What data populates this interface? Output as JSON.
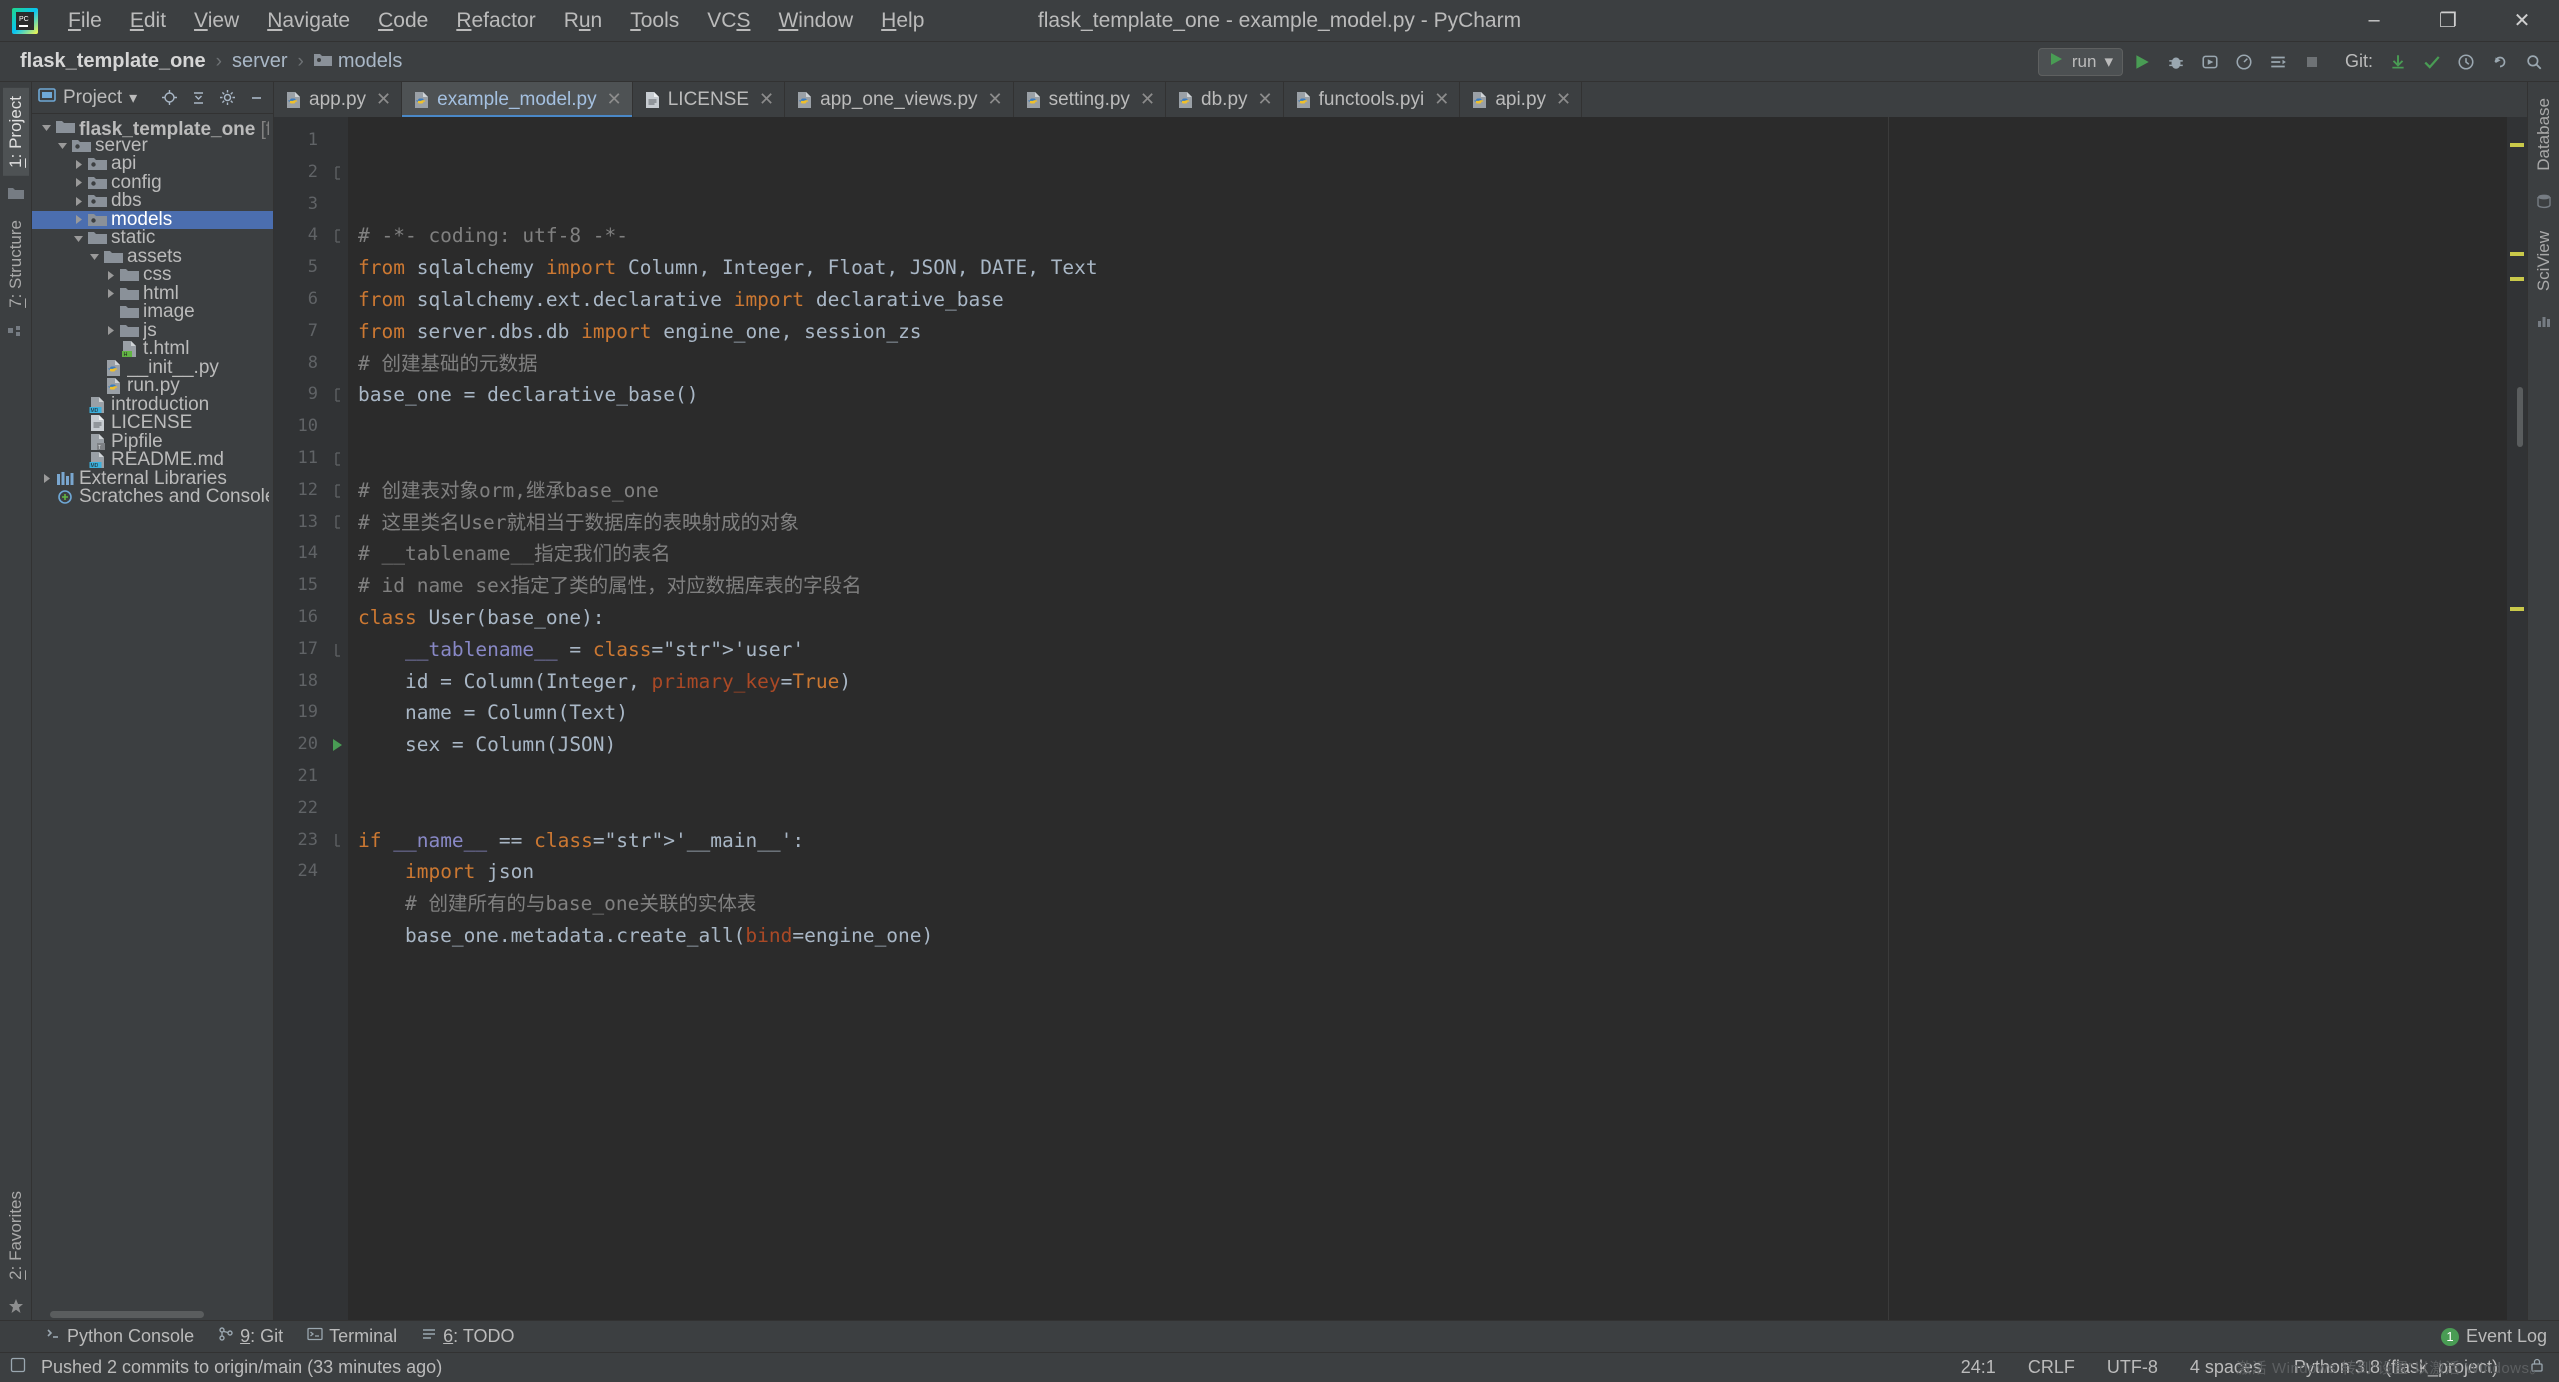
{
  "window": {
    "title": "flask_template_one - example_model.py - PyCharm",
    "minimize": "–",
    "maximize": "❐",
    "close": "✕",
    "app_icon": "pycharm-logo-icon"
  },
  "menubar": {
    "items": [
      {
        "label": "File",
        "mnemonic": "F"
      },
      {
        "label": "Edit",
        "mnemonic": "E"
      },
      {
        "label": "View",
        "mnemonic": "V"
      },
      {
        "label": "Navigate",
        "mnemonic": "N"
      },
      {
        "label": "Code",
        "mnemonic": "C"
      },
      {
        "label": "Refactor",
        "mnemonic": "R"
      },
      {
        "label": "Run",
        "mnemonic": "u"
      },
      {
        "label": "Tools",
        "mnemonic": "T"
      },
      {
        "label": "VCS",
        "mnemonic": "S"
      },
      {
        "label": "Window",
        "mnemonic": "W"
      },
      {
        "label": "Help",
        "mnemonic": "H"
      }
    ]
  },
  "navbar": {
    "breadcrumb": [
      {
        "label": "flask_template_one",
        "bold": true,
        "icon": ""
      },
      {
        "label": "server",
        "bold": false,
        "icon": ""
      },
      {
        "label": "models",
        "bold": false,
        "icon": "folder-icon"
      }
    ],
    "separator": "›",
    "run_config": {
      "label": "run",
      "icon": "run-config-icon",
      "chevron": "▾"
    },
    "buttons": [
      {
        "name": "run-button",
        "glyph": "▶",
        "color": "#499c54"
      },
      {
        "name": "debug-button",
        "glyph": "bug-icon",
        "color": "#9aa7b0"
      },
      {
        "name": "run-with-coverage-button",
        "glyph": "coverage-icon",
        "color": "#9aa7b0"
      },
      {
        "name": "profile-button",
        "glyph": "profile-icon",
        "color": "#9aa7b0"
      },
      {
        "name": "attach-button",
        "glyph": "attach-icon",
        "color": "#9aa7b0"
      },
      {
        "name": "stop-button",
        "glyph": "■",
        "color": "#787878"
      }
    ],
    "git_label": "Git:",
    "git_buttons": [
      {
        "name": "update-project-button",
        "glyph": "↙",
        "color": "#499c54"
      },
      {
        "name": "commit-button",
        "glyph": "✓",
        "color": "#499c54"
      },
      {
        "name": "history-button",
        "glyph": "clock-icon",
        "color": "#9aa7b0"
      },
      {
        "name": "rollback-button",
        "glyph": "↶",
        "color": "#9aa7b0"
      },
      {
        "name": "search-everywhere-button",
        "glyph": "search-icon",
        "color": "#9aa7b0"
      }
    ]
  },
  "left_rail": {
    "top": [
      {
        "label": "1: Project",
        "mnemonic": "1",
        "active": true,
        "name": "tool-window-project"
      },
      {
        "label": "7: Structure",
        "mnemonic": "7",
        "active": false,
        "name": "tool-window-structure"
      }
    ],
    "bottom": [
      {
        "label": "2: Favorites",
        "mnemonic": "2",
        "active": false,
        "name": "tool-window-favorites"
      }
    ],
    "icons": [
      "folder-icon",
      "structure-icon",
      "star-icon"
    ]
  },
  "right_rail": {
    "items": [
      {
        "label": "Database",
        "name": "tool-window-database"
      },
      {
        "label": "SciView",
        "name": "tool-window-sciview"
      }
    ]
  },
  "project_panel": {
    "title": "Project",
    "chevron": "▾",
    "toolbar": [
      {
        "name": "locate-button",
        "glyph": "target-icon"
      },
      {
        "name": "collapse-all-button",
        "glyph": "collapse-icon"
      },
      {
        "name": "settings-button",
        "glyph": "gear-icon"
      },
      {
        "name": "hide-button",
        "glyph": "—"
      }
    ],
    "tree": [
      {
        "depth": 0,
        "label": "flask_template_one",
        "suffix": " [flask_project] E:\\我",
        "twisty": "down",
        "icon": "folder-root-icon",
        "selected": false
      },
      {
        "depth": 1,
        "label": "server",
        "suffix": "",
        "twisty": "down",
        "icon": "folder-source-icon",
        "selected": false
      },
      {
        "depth": 2,
        "label": "api",
        "suffix": "",
        "twisty": "right",
        "icon": "folder-source-icon",
        "selected": false
      },
      {
        "depth": 2,
        "label": "config",
        "suffix": "",
        "twisty": "right",
        "icon": "folder-source-icon",
        "selected": false
      },
      {
        "depth": 2,
        "label": "dbs",
        "suffix": "",
        "twisty": "right",
        "icon": "folder-source-icon",
        "selected": false
      },
      {
        "depth": 2,
        "label": "models",
        "suffix": "",
        "twisty": "right",
        "icon": "folder-source-icon",
        "selected": true
      },
      {
        "depth": 2,
        "label": "static",
        "suffix": "",
        "twisty": "down",
        "icon": "folder-icon",
        "selected": false
      },
      {
        "depth": 3,
        "label": "assets",
        "suffix": "",
        "twisty": "down",
        "icon": "folder-icon",
        "selected": false
      },
      {
        "depth": 4,
        "label": "css",
        "suffix": "",
        "twisty": "right",
        "icon": "folder-icon",
        "selected": false
      },
      {
        "depth": 4,
        "label": "html",
        "suffix": "",
        "twisty": "right",
        "icon": "folder-icon",
        "selected": false
      },
      {
        "depth": 4,
        "label": "image",
        "suffix": "",
        "twisty": "none",
        "icon": "folder-icon",
        "selected": false
      },
      {
        "depth": 4,
        "label": "js",
        "suffix": "",
        "twisty": "right",
        "icon": "folder-icon",
        "selected": false
      },
      {
        "depth": 4,
        "label": "t.html",
        "suffix": "",
        "twisty": "none",
        "icon": "html-file-icon",
        "selected": false
      },
      {
        "depth": 3,
        "label": "__init__.py",
        "suffix": "",
        "twisty": "none",
        "icon": "python-file-icon",
        "selected": false
      },
      {
        "depth": 3,
        "label": "run.py",
        "suffix": "",
        "twisty": "none",
        "icon": "python-file-icon",
        "selected": false
      },
      {
        "depth": 2,
        "label": "introduction",
        "suffix": "",
        "twisty": "none",
        "icon": "markdown-file-icon",
        "selected": false
      },
      {
        "depth": 2,
        "label": "LICENSE",
        "suffix": "",
        "twisty": "none",
        "icon": "text-file-icon",
        "selected": false
      },
      {
        "depth": 2,
        "label": "Pipfile",
        "suffix": "",
        "twisty": "none",
        "icon": "pipfile-icon",
        "selected": false
      },
      {
        "depth": 2,
        "label": "README.md",
        "suffix": "",
        "twisty": "none",
        "icon": "markdown-file-icon",
        "selected": false
      },
      {
        "depth": 0,
        "label": "External Libraries",
        "suffix": "",
        "twisty": "right",
        "icon": "library-icon",
        "selected": false
      },
      {
        "depth": 0,
        "label": "Scratches and Consoles",
        "suffix": "",
        "twisty": "none",
        "icon": "scratches-icon",
        "selected": false
      }
    ]
  },
  "editor": {
    "tabs": [
      {
        "label": "app.py",
        "icon": "python-file-icon",
        "active": false,
        "close": "✕"
      },
      {
        "label": "example_model.py",
        "icon": "python-file-icon",
        "active": true,
        "close": "✕"
      },
      {
        "label": "LICENSE",
        "icon": "text-file-icon",
        "active": false,
        "close": "✕"
      },
      {
        "label": "app_one_views.py",
        "icon": "python-file-icon",
        "active": false,
        "close": "✕"
      },
      {
        "label": "setting.py",
        "icon": "python-file-icon",
        "active": false,
        "close": "✕"
      },
      {
        "label": "db.py",
        "icon": "python-file-icon",
        "active": false,
        "close": "✕"
      },
      {
        "label": "functools.pyi",
        "icon": "python-file-icon",
        "active": false,
        "close": "✕"
      },
      {
        "label": "api.py",
        "icon": "python-file-icon",
        "active": false,
        "close": "✕"
      }
    ],
    "line_numbers": [
      "1",
      "2",
      "3",
      "4",
      "5",
      "6",
      "7",
      "8",
      "9",
      "10",
      "11",
      "12",
      "13",
      "14",
      "15",
      "16",
      "17",
      "18",
      "19",
      "20",
      "21",
      "22",
      "23",
      "24"
    ],
    "code_lines": [
      "# -*- coding: utf-8 -*-",
      "from sqlalchemy import Column, Integer, Float, JSON, DATE, Text",
      "from sqlalchemy.ext.declarative import declarative_base",
      "from server.dbs.db import engine_one, session_zs",
      "# 创建基础的元数据",
      "base_one = declarative_base()",
      "",
      "",
      "# 创建表对象orm,继承base_one",
      "# 这里类名User就相当于数据库的表映射成的对象",
      "# __tablename__指定我们的表名",
      "# id name sex指定了类的属性，对应数据库表的字段名",
      "class User(base_one):",
      "    __tablename__ = 'user'",
      "    id = Column(Integer, primary_key=True)",
      "    name = Column(Text)",
      "    sex = Column(JSON)",
      "",
      "",
      "if __name__ == '__main__':",
      "    import json",
      "    # 创建所有的与base_one关联的实体表",
      "    base_one.metadata.create_all(bind=engine_one)",
      ""
    ]
  },
  "bottom_tools": [
    {
      "label": "Python Console",
      "icon": "python-console-icon",
      "mnemonic": "",
      "name": "tool-window-python-console"
    },
    {
      "label": "9: Git",
      "icon": "git-icon",
      "mnemonic": "9",
      "name": "tool-window-git"
    },
    {
      "label": "Terminal",
      "icon": "terminal-icon",
      "mnemonic": "",
      "name": "tool-window-terminal"
    },
    {
      "label": "6: TODO",
      "icon": "todo-icon",
      "mnemonic": "6",
      "name": "tool-window-todo"
    }
  ],
  "event_log": {
    "label": "Event Log",
    "badge": "1"
  },
  "statusbar": {
    "message": "Pushed 2 commits to origin/main (33 minutes ago)",
    "message_icon": "info-icon",
    "caret": "24:1",
    "line_separator": "CRLF",
    "encoding": "UTF-8",
    "indent": "4 spaces",
    "interpreter": "Python 3.8 (flask_project)",
    "lock_icon": "lock-icon"
  },
  "watermark": "激活 Windows 转到“设置”以激活 Windows。",
  "colors": {
    "accent": "#4b6eaf",
    "editor_bg": "#2b2b2b",
    "panel_bg": "#3c3f41",
    "gutter_bg": "#313335",
    "text": "#bbbbbb",
    "keyword": "#cc7832",
    "string": "#6a8759",
    "comment": "#808080",
    "number": "#6897bb",
    "function": "#ffc66d",
    "green": "#499c54"
  }
}
